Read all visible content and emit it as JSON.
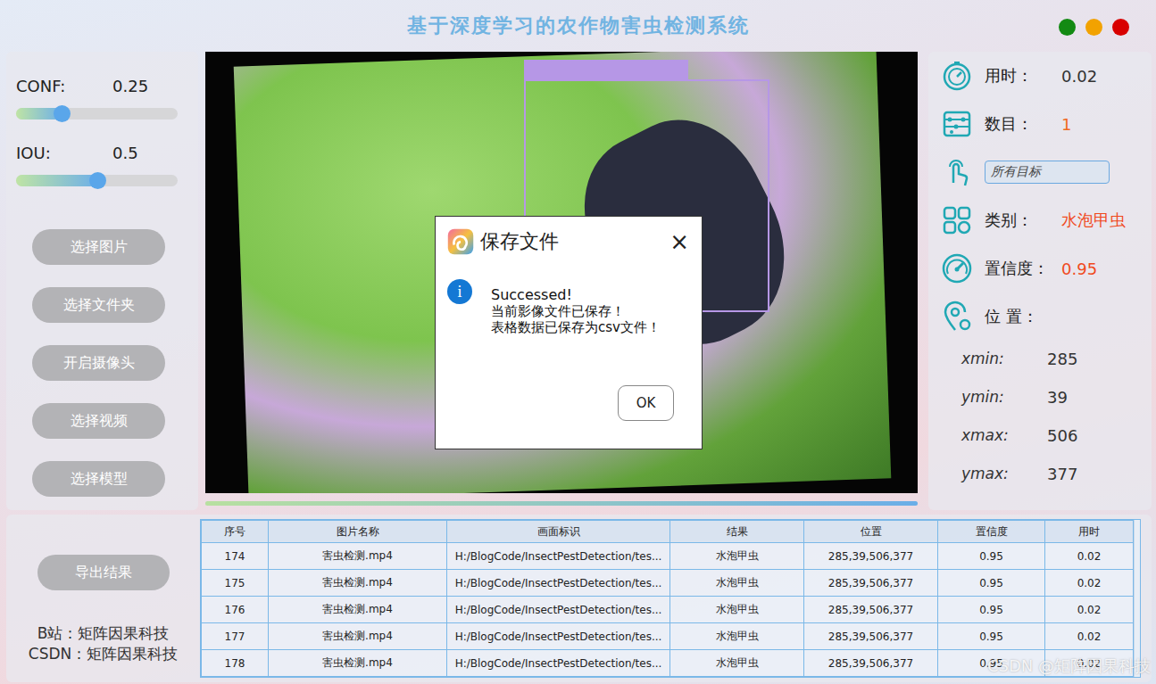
{
  "window": {
    "title": "基于深度学习的农作物害虫检测系统",
    "controls": [
      {
        "color": "#138a13"
      },
      {
        "color": "#f2a200"
      },
      {
        "color": "#d80000"
      }
    ]
  },
  "params": [
    {
      "label": "CONF:",
      "value": "0.25",
      "level": 0.28
    },
    {
      "label": "IOU:",
      "value": "0.5",
      "level": 0.5
    }
  ],
  "buttons": [
    "选择图片",
    "选择文件夹",
    "开启摄像头",
    "选择视频",
    "选择模型"
  ],
  "progress": {
    "level": 1
  },
  "stats": [
    {
      "kind": "value",
      "label": "用时：",
      "value": "0.02",
      "color": "#333333"
    },
    {
      "kind": "value",
      "label": "数目：",
      "value": "1",
      "color": "#f06a1e"
    },
    {
      "kind": "filter",
      "value": "所有目标"
    },
    {
      "kind": "value",
      "label": "类别：",
      "value": "水泡甲虫",
      "color": "#f04a1e"
    },
    {
      "kind": "value",
      "label": "置信度：",
      "value": "0.95",
      "color": "#f04a1e"
    },
    {
      "kind": "value",
      "label": "位 置：",
      "value": "",
      "color": "#333333"
    }
  ],
  "position": [
    {
      "label": "xmin:",
      "value": "285"
    },
    {
      "label": "ymin:",
      "value": "39"
    },
    {
      "label": "xmax:",
      "value": "506"
    },
    {
      "label": "ymax:",
      "value": "377"
    }
  ],
  "export_button": "导出结果",
  "credits": [
    "B站：矩阵因果科技",
    "CSDN：矩阵因果科技"
  ],
  "table": {
    "columns": [
      "序号",
      "图片名称",
      "画面标识",
      "结果",
      "位置",
      "置信度",
      "用时"
    ],
    "rows": [
      [
        "174",
        "害虫检测.mp4",
        "H:/BlogCode/InsectPestDetection/tes...",
        "水泡甲虫",
        "285,39,506,377",
        "0.95",
        "0.02"
      ],
      [
        "175",
        "害虫检测.mp4",
        "H:/BlogCode/InsectPestDetection/tes...",
        "水泡甲虫",
        "285,39,506,377",
        "0.95",
        "0.02"
      ],
      [
        "176",
        "害虫检测.mp4",
        "H:/BlogCode/InsectPestDetection/tes...",
        "水泡甲虫",
        "285,39,506,377",
        "0.95",
        "0.02"
      ],
      [
        "177",
        "害虫检测.mp4",
        "H:/BlogCode/InsectPestDetection/tes...",
        "水泡甲虫",
        "285,39,506,377",
        "0.95",
        "0.02"
      ],
      [
        "178",
        "害虫检测.mp4",
        "H:/BlogCode/InsectPestDetection/tes...",
        "水泡甲虫",
        "285,39,506,377",
        "0.95",
        "0.02"
      ]
    ]
  },
  "dialog": {
    "title": "保存文件",
    "close": "×",
    "info_icon": "i",
    "heading": "Successed!",
    "lines": [
      "当前影像文件已保存！",
      "表格数据已保存为csv文件！"
    ],
    "ok": "OK"
  },
  "watermark": "CSDN @矩阵因果科技"
}
